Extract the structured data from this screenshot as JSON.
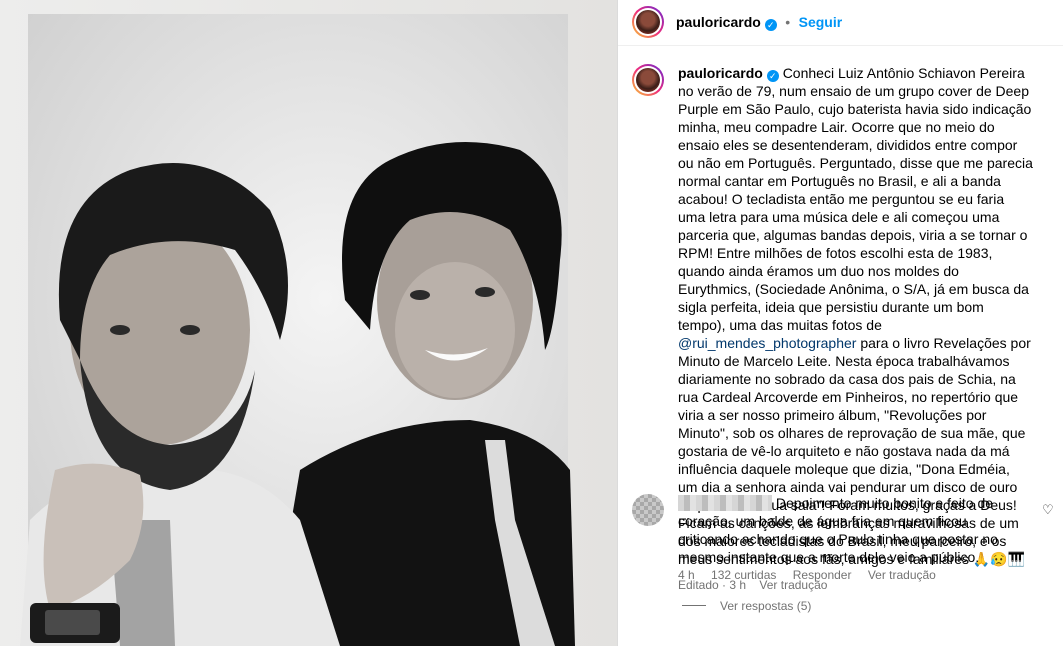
{
  "post": {
    "image_alt": "black-and-white portrait of two men on a book page",
    "header": {
      "username": "pauloricardo",
      "separator": "•",
      "follow_label": "Seguir"
    },
    "caption": {
      "username": "pauloricardo",
      "text_before_mention": "Conheci Luiz Antônio Schiavon Pereira no verão de 79, num ensaio de um grupo cover de Deep Purple em São Paulo, cujo baterista havia sido indicação minha, meu compadre Lair. Ocorre que no meio do ensaio eles se desentenderam, divididos entre compor ou não em Português. Perguntado, disse que me parecia normal cantar em Português no Brasil, e ali a banda acabou! O tecladista então me perguntou se eu faria uma letra para uma música dele e ali começou uma parceria que, algumas bandas depois, viria a se tornar o RPM! Entre milhões de fotos escolhi esta de 1983, quando ainda éramos um duo nos moldes do Eurythmics, (Sociedade Anônima, o S/A, já em busca da sigla perfeita, ideia que persistiu durante um bom tempo), uma das muitas fotos de",
      "mention": "@rui_mendes_photographer",
      "text_after_mention": "para o livro Revelações por Minuto de Marcelo Leite. Nesta época trabalhávamos diariamente no sobrado da casa dos pais de Schia, na rua Cardeal Arcoverde em Pinheiros, no repertório que viria a ser nosso primeiro álbum, \"Revoluções por Minuto\", sob os olhares de reprovação de sua mãe, que gostaria de vê-lo arquiteto e não gostava nada da má influência daquele moleque que dizia, \"Dona Edméia, um dia a senhora ainda vai pendurar um disco de ouro na parede da sua sala\"! Foram muitos, graças a Deus! Ficam as canções, as lembranças maravilhosas de um dos maiores tecladistas do Brasil, meu parceiro, e os meus sentimentos aos fãs, amigos e familiares 🙏😥🎹",
      "edited_label": "Editado · 3 h",
      "translate_label": "Ver tradução"
    },
    "comment": {
      "text": "Depoimento muito bonito e feito de coração, um balde de água fria em quem ficou criticando achando que o Paulo tinha que postar no mesmo instante que a morte dele veio a público.",
      "time": "4 h",
      "likes": "132 curtidas",
      "reply_label": "Responder",
      "translate_label": "Ver tradução",
      "view_replies_label": "Ver respostas (5)"
    },
    "icons": {
      "verified": "verified-badge-icon",
      "heart": "heart-icon"
    },
    "colors": {
      "accent": "#0095f6",
      "mention": "#00376b",
      "meta": "#737373"
    }
  }
}
